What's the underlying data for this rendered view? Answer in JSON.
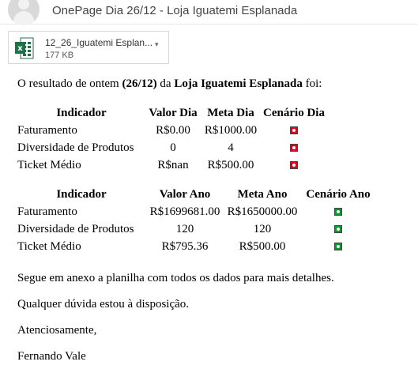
{
  "email": {
    "subject": "OnePage Dia 26/12 - Loja Iguatemi Esplanada"
  },
  "attachment": {
    "name": "12_26_Iguatemi Esplan...",
    "size": "177 KB"
  },
  "body": {
    "intro_prefix": "O resultado de ontem ",
    "intro_date": "(26/12)",
    "intro_mid": " da ",
    "intro_store": "Loja Iguatemi Esplanada",
    "intro_suffix": " foi:",
    "outro_1": "Segue em anexo a planilha com todos os dados para mais detalhes.",
    "outro_2": "Qualquer dúvida estou à disposição.",
    "closing": "Atenciosamente,",
    "signature": "Fernando Vale"
  },
  "table_day": {
    "headers": [
      "Indicador",
      "Valor Dia",
      "Meta Dia",
      "Cenário Dia"
    ],
    "rows": [
      {
        "indicator": "Faturamento",
        "value": "R$0.00",
        "target": "R$1000.00",
        "status": "red"
      },
      {
        "indicator": "Diversidade de Produtos",
        "value": "0",
        "target": "4",
        "status": "red"
      },
      {
        "indicator": "Ticket Médio",
        "value": "R$nan",
        "target": "R$500.00",
        "status": "red"
      }
    ]
  },
  "table_year": {
    "headers": [
      "Indicador",
      "Valor Ano",
      "Meta Ano",
      "Cenário Ano"
    ],
    "rows": [
      {
        "indicator": "Faturamento",
        "value": "R$1699681.00",
        "target": "R$1650000.00",
        "status": "green"
      },
      {
        "indicator": "Diversidade de Produtos",
        "value": "120",
        "target": "120",
        "status": "green"
      },
      {
        "indicator": "Ticket Médio",
        "value": "R$795.36",
        "target": "R$500.00",
        "status": "green"
      }
    ]
  },
  "colors": {
    "red": "#e0001a",
    "green": "#009a2e",
    "excel_green": "#1e7145"
  }
}
